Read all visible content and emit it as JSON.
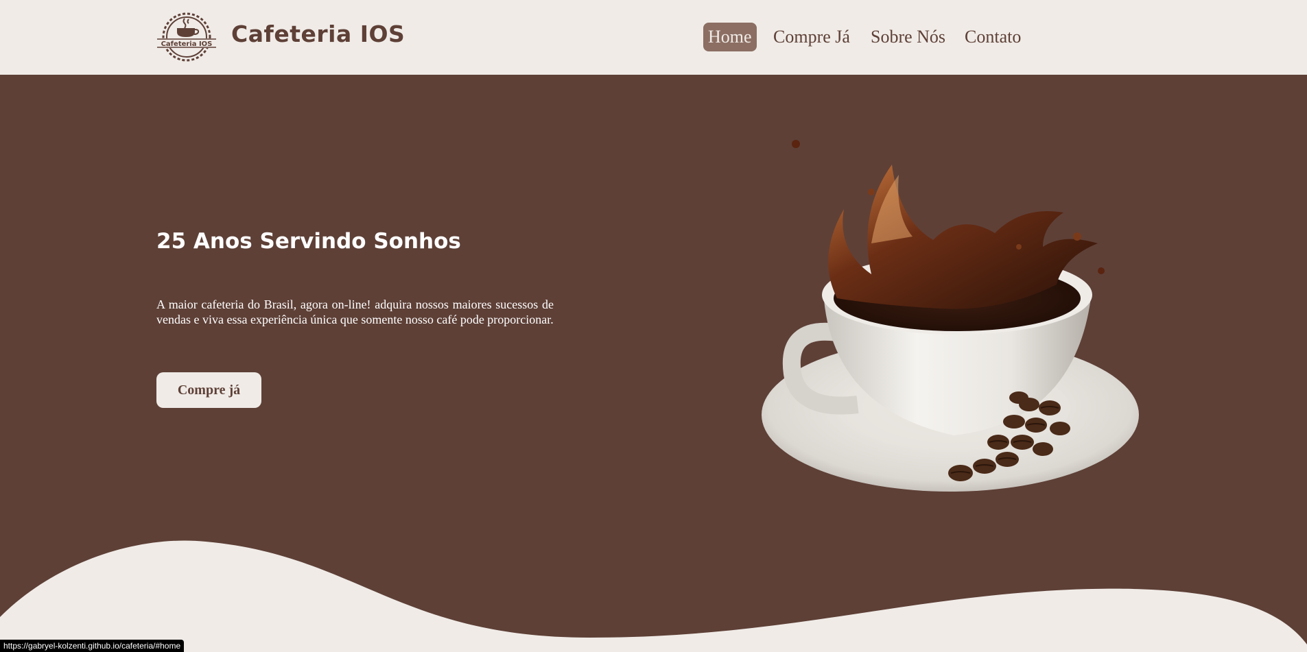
{
  "header": {
    "logo_text": "Cafeteria IOS",
    "brand": "Cafeteria IOS",
    "nav": [
      {
        "label": "Home",
        "active": true
      },
      {
        "label": "Compre Já",
        "active": false
      },
      {
        "label": "Sobre Nós",
        "active": false
      },
      {
        "label": "Contato",
        "active": false
      }
    ]
  },
  "hero": {
    "title": "25 Anos Servindo Sonhos",
    "text": "A maior cafeteria do Brasil, agora on-line! adquira nossos maiores sucessos de vendas e viva essa experiência única que somente nosso café pode proporcionar.",
    "cta_label": "Compre já",
    "image": "coffee-cup-splash-with-beans"
  },
  "status_bar": {
    "url": "https://gabryel-kolzenti.github.io/cafeteria/#home"
  },
  "colors": {
    "header_bg": "#f0ebe7",
    "hero_bg": "#5e4037",
    "accent": "#8c6e63",
    "text_light": "#ffffff"
  }
}
